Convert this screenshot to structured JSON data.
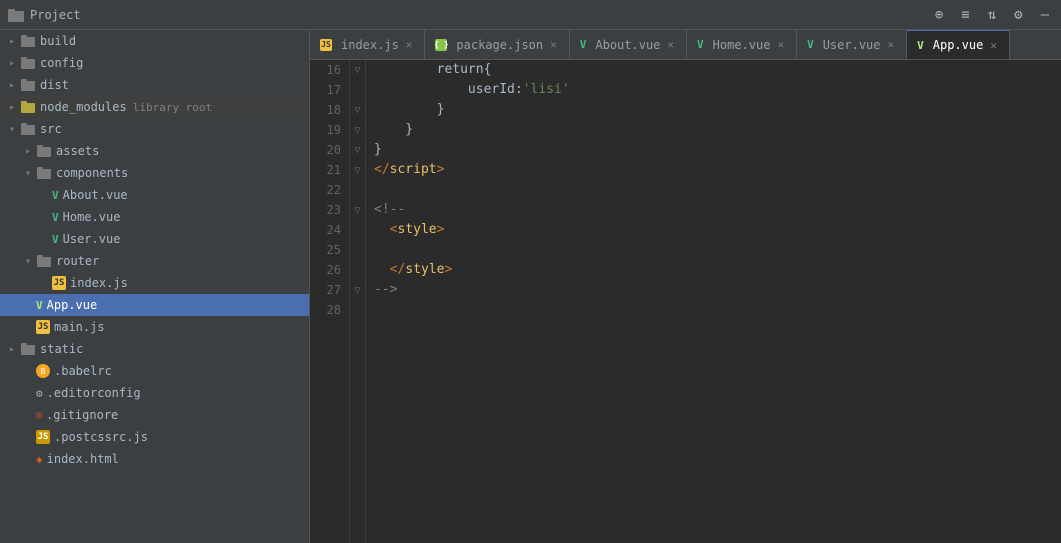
{
  "titleBar": {
    "projectLabel": "Project",
    "icons": [
      "project-icon",
      "add-icon",
      "sort-icon",
      "filter-icon",
      "settings-icon",
      "minimize-icon"
    ]
  },
  "tabs": [
    {
      "id": "index-js",
      "label": "index.js",
      "type": "js",
      "active": false
    },
    {
      "id": "package-json",
      "label": "package.json",
      "type": "json",
      "active": false
    },
    {
      "id": "about-vue",
      "label": "About.vue",
      "type": "vue",
      "active": false
    },
    {
      "id": "home-vue",
      "label": "Home.vue",
      "type": "vue",
      "active": false
    },
    {
      "id": "user-vue",
      "label": "User.vue",
      "type": "vue",
      "active": false
    },
    {
      "id": "app-vue",
      "label": "App.vue",
      "type": "vue",
      "active": true
    }
  ],
  "sidebar": {
    "projectName": "Project",
    "tree": [
      {
        "id": "build",
        "label": "build",
        "type": "folder",
        "depth": 1,
        "open": false
      },
      {
        "id": "config",
        "label": "config",
        "type": "folder",
        "depth": 1,
        "open": false
      },
      {
        "id": "dist",
        "label": "dist",
        "type": "folder",
        "depth": 1,
        "open": false
      },
      {
        "id": "node_modules",
        "label": "node_modules",
        "type": "folder",
        "depth": 1,
        "open": false,
        "badge": "library root"
      },
      {
        "id": "src",
        "label": "src",
        "type": "folder",
        "depth": 1,
        "open": true
      },
      {
        "id": "assets",
        "label": "assets",
        "type": "folder",
        "depth": 2,
        "open": false
      },
      {
        "id": "components",
        "label": "components",
        "type": "folder",
        "depth": 2,
        "open": true
      },
      {
        "id": "About.vue",
        "label": "About.vue",
        "type": "vue",
        "depth": 3
      },
      {
        "id": "Home.vue",
        "label": "Home.vue",
        "type": "vue",
        "depth": 3
      },
      {
        "id": "User.vue",
        "label": "User.vue",
        "type": "vue",
        "depth": 3
      },
      {
        "id": "router",
        "label": "router",
        "type": "folder",
        "depth": 2,
        "open": true
      },
      {
        "id": "router-index.js",
        "label": "index.js",
        "type": "js",
        "depth": 3
      },
      {
        "id": "App.vue",
        "label": "App.vue",
        "type": "vue",
        "depth": 2,
        "selected": true
      },
      {
        "id": "main.js",
        "label": "main.js",
        "type": "js",
        "depth": 2
      },
      {
        "id": "static",
        "label": "static",
        "type": "folder",
        "depth": 1,
        "open": false
      },
      {
        "id": ".babelrc",
        "label": ".babelrc",
        "type": "babelrc",
        "depth": 1
      },
      {
        "id": ".editorconfig",
        "label": ".editorconfig",
        "type": "gear",
        "depth": 1
      },
      {
        "id": ".gitignore",
        "label": ".gitignore",
        "type": "git",
        "depth": 1
      },
      {
        "id": ".postcssrc.js",
        "label": ".postcssrc.js",
        "type": "js-small",
        "depth": 1
      },
      {
        "id": "index.html",
        "label": "index.html",
        "type": "html",
        "depth": 1
      }
    ]
  },
  "codeLines": [
    {
      "num": 16,
      "foldIcon": "▽",
      "content": [
        {
          "t": "return{",
          "c": "c-white"
        }
      ]
    },
    {
      "num": 17,
      "foldIcon": "",
      "content": [
        {
          "t": "        userId:",
          "c": "c-white"
        },
        {
          "t": "'lisi'",
          "c": "c-string"
        }
      ]
    },
    {
      "num": 18,
      "foldIcon": "▽",
      "content": [
        {
          "t": "    }",
          "c": "c-white"
        }
      ]
    },
    {
      "num": 19,
      "foldIcon": "▽",
      "content": [
        {
          "t": "  }",
          "c": "c-white"
        }
      ]
    },
    {
      "num": 20,
      "foldIcon": "▽",
      "content": [
        {
          "t": "}",
          "c": "c-white"
        }
      ]
    },
    {
      "num": 21,
      "foldIcon": "▽",
      "content": [
        {
          "t": "</",
          "c": "c-bracket"
        },
        {
          "t": "script",
          "c": "c-tag"
        },
        {
          "t": ">",
          "c": "c-bracket"
        }
      ]
    },
    {
      "num": 22,
      "foldIcon": "",
      "content": []
    },
    {
      "num": 23,
      "foldIcon": "▽",
      "content": [
        {
          "t": "<!--",
          "c": "c-comment"
        }
      ]
    },
    {
      "num": 24,
      "foldIcon": "",
      "content": [
        {
          "t": "  <",
          "c": "c-bracket"
        },
        {
          "t": "style",
          "c": "c-tag"
        },
        {
          "t": ">",
          "c": "c-bracket"
        }
      ]
    },
    {
      "num": 25,
      "foldIcon": "",
      "content": []
    },
    {
      "num": 26,
      "foldIcon": "",
      "content": [
        {
          "t": "  </",
          "c": "c-bracket"
        },
        {
          "t": "style",
          "c": "c-tag"
        },
        {
          "t": ">",
          "c": "c-bracket"
        }
      ]
    },
    {
      "num": 27,
      "foldIcon": "▽",
      "content": [
        {
          "t": "-->",
          "c": "c-comment"
        }
      ]
    },
    {
      "num": 28,
      "foldIcon": "",
      "content": []
    }
  ],
  "colors": {
    "sidebar_bg": "#3c3f41",
    "editor_bg": "#2b2b2b",
    "selected_bg": "#4b6eaf",
    "active_tab_bg": "#2b2b2b",
    "tab_bar_bg": "#3c3f41"
  }
}
